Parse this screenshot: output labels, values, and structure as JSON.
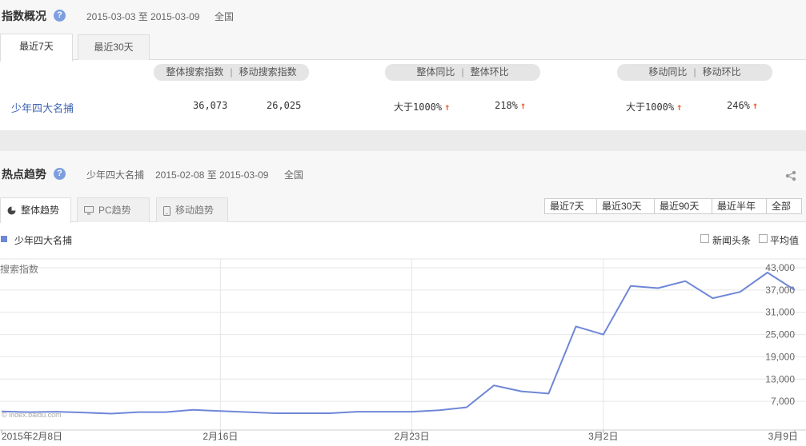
{
  "overview": {
    "title": "指数概况",
    "help": "?",
    "date_range": "2015-03-03 至 2015-03-09",
    "region": "全国",
    "tabs": [
      "最近7天",
      "最近30天"
    ],
    "headers": {
      "search": "整体搜索指数",
      "mobile_search": "移动搜索指数",
      "yoy": "整体同比",
      "mom": "整体环比",
      "mobile_yoy": "移动同比",
      "mobile_mom": "移动环比",
      "sep": "|"
    },
    "row": {
      "keyword": "少年四大名捕",
      "search_index": "36,073",
      "mobile_index": "26,025",
      "yoy": "大于1000%",
      "mom": "218%",
      "mobile_yoy": "大于1000%",
      "mobile_mom": "246%",
      "arrow": "↑"
    }
  },
  "trend": {
    "title": "热点趋势",
    "help": "?",
    "keyword": "少年四大名捕",
    "date_range": "2015-02-08 至 2015-03-09",
    "region": "全国",
    "tabs": [
      "整体趋势",
      "PC趋势",
      "移动趋势"
    ],
    "ranges": [
      "最近7天",
      "最近30天",
      "最近90天",
      "最近半年",
      "全部"
    ],
    "legend": "少年四大名捕",
    "options": [
      "新闻头条",
      "平均值"
    ],
    "y_title": "搜索指数",
    "watermark": "© index.baidu.com",
    "colors": {
      "series": "#6f87d8",
      "arrow": "#e8602c",
      "link": "#3f64b2"
    }
  },
  "chart_data": {
    "type": "line",
    "title": "",
    "xlabel": "",
    "ylabel": "搜索指数",
    "ylim": [
      1000,
      43000
    ],
    "yticks": [
      "7,000",
      "13,000",
      "19,000",
      "25,000",
      "31,000",
      "37,000",
      "43,000"
    ],
    "ytick_values": [
      7000,
      13000,
      19000,
      25000,
      31000,
      37000,
      43000
    ],
    "xtick_labels": [
      "2015年2月8日",
      "2月16日",
      "2月23日",
      "3月2日",
      "3月9日"
    ],
    "xtick_index": [
      0,
      8,
      15,
      22,
      29
    ],
    "grid": true,
    "series": [
      {
        "name": "少年四大名捕",
        "x": [
          "2015-02-08",
          "2015-02-09",
          "2015-02-10",
          "2015-02-11",
          "2015-02-12",
          "2015-02-13",
          "2015-02-14",
          "2015-02-15",
          "2015-02-16",
          "2015-02-17",
          "2015-02-18",
          "2015-02-19",
          "2015-02-20",
          "2015-02-21",
          "2015-02-22",
          "2015-02-23",
          "2015-02-24",
          "2015-02-25",
          "2015-02-26",
          "2015-02-27",
          "2015-02-28",
          "2015-03-01",
          "2015-03-02",
          "2015-03-03",
          "2015-03-04",
          "2015-03-05",
          "2015-03-06",
          "2015-03-07",
          "2015-03-08",
          "2015-03-09"
        ],
        "values": [
          4300,
          4100,
          4200,
          4000,
          3700,
          4100,
          4100,
          4700,
          4400,
          4100,
          3800,
          3800,
          3800,
          4200,
          4200,
          4200,
          4600,
          5400,
          11300,
          9700,
          9100,
          27200,
          25000,
          38100,
          37500,
          39400,
          34800,
          36500,
          41700,
          37000
        ]
      }
    ]
  }
}
